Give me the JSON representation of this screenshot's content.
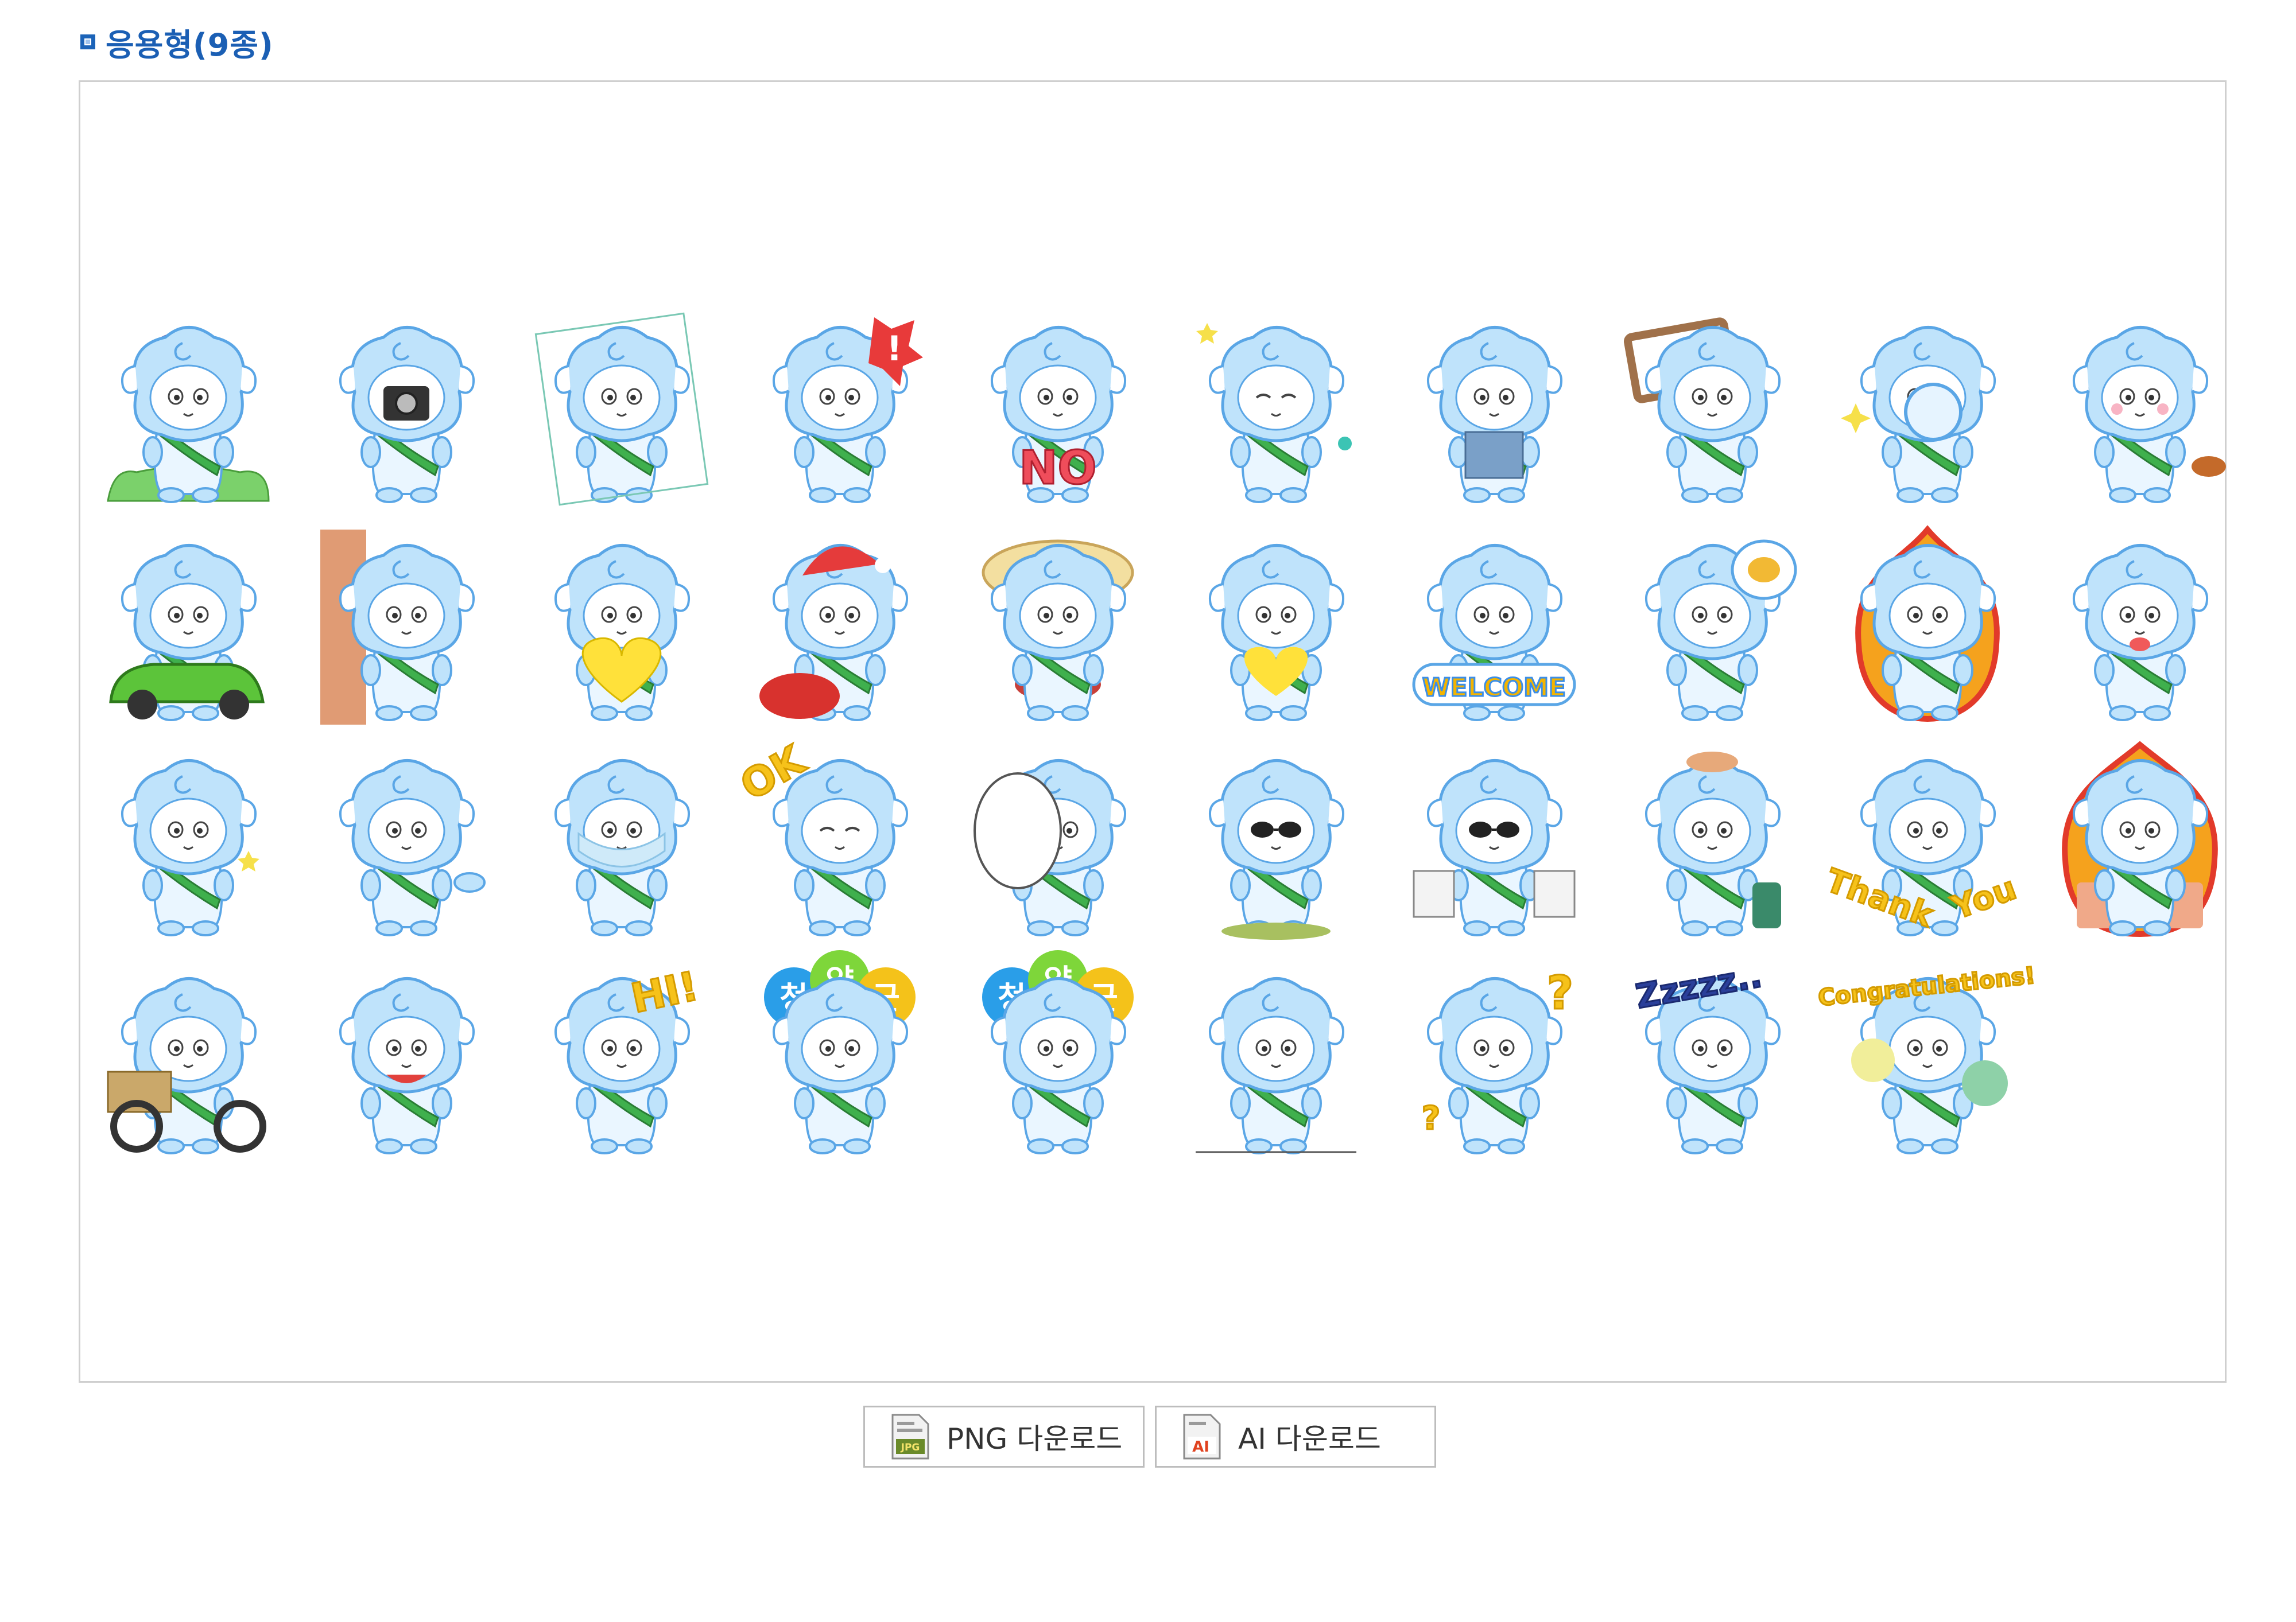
{
  "section": {
    "title": "응용형(9종)"
  },
  "gallery": {
    "sticker_count": 37,
    "balloon_text": [
      "청",
      "양",
      "군"
    ],
    "texts": {
      "no": "NO",
      "welcome": "WELCOME",
      "ok": "OK",
      "thank": "Thank",
      "you": "You",
      "hi": "HI!",
      "zzz": "Zzzzz..",
      "congrats": "Congratulations!",
      "question": "?",
      "exclaim": "!"
    }
  },
  "downloads": {
    "png_label": "PNG 다운로드",
    "png_icon_text": "JPG",
    "ai_label": "AI 다운로드",
    "ai_icon_text": "AI"
  },
  "colors": {
    "title": "#1b5fb4",
    "character_fill": "#bfe3fb",
    "character_stroke": "#5aa6e6",
    "sash": "#3fb04d",
    "frame_border": "#cfcfcf"
  }
}
